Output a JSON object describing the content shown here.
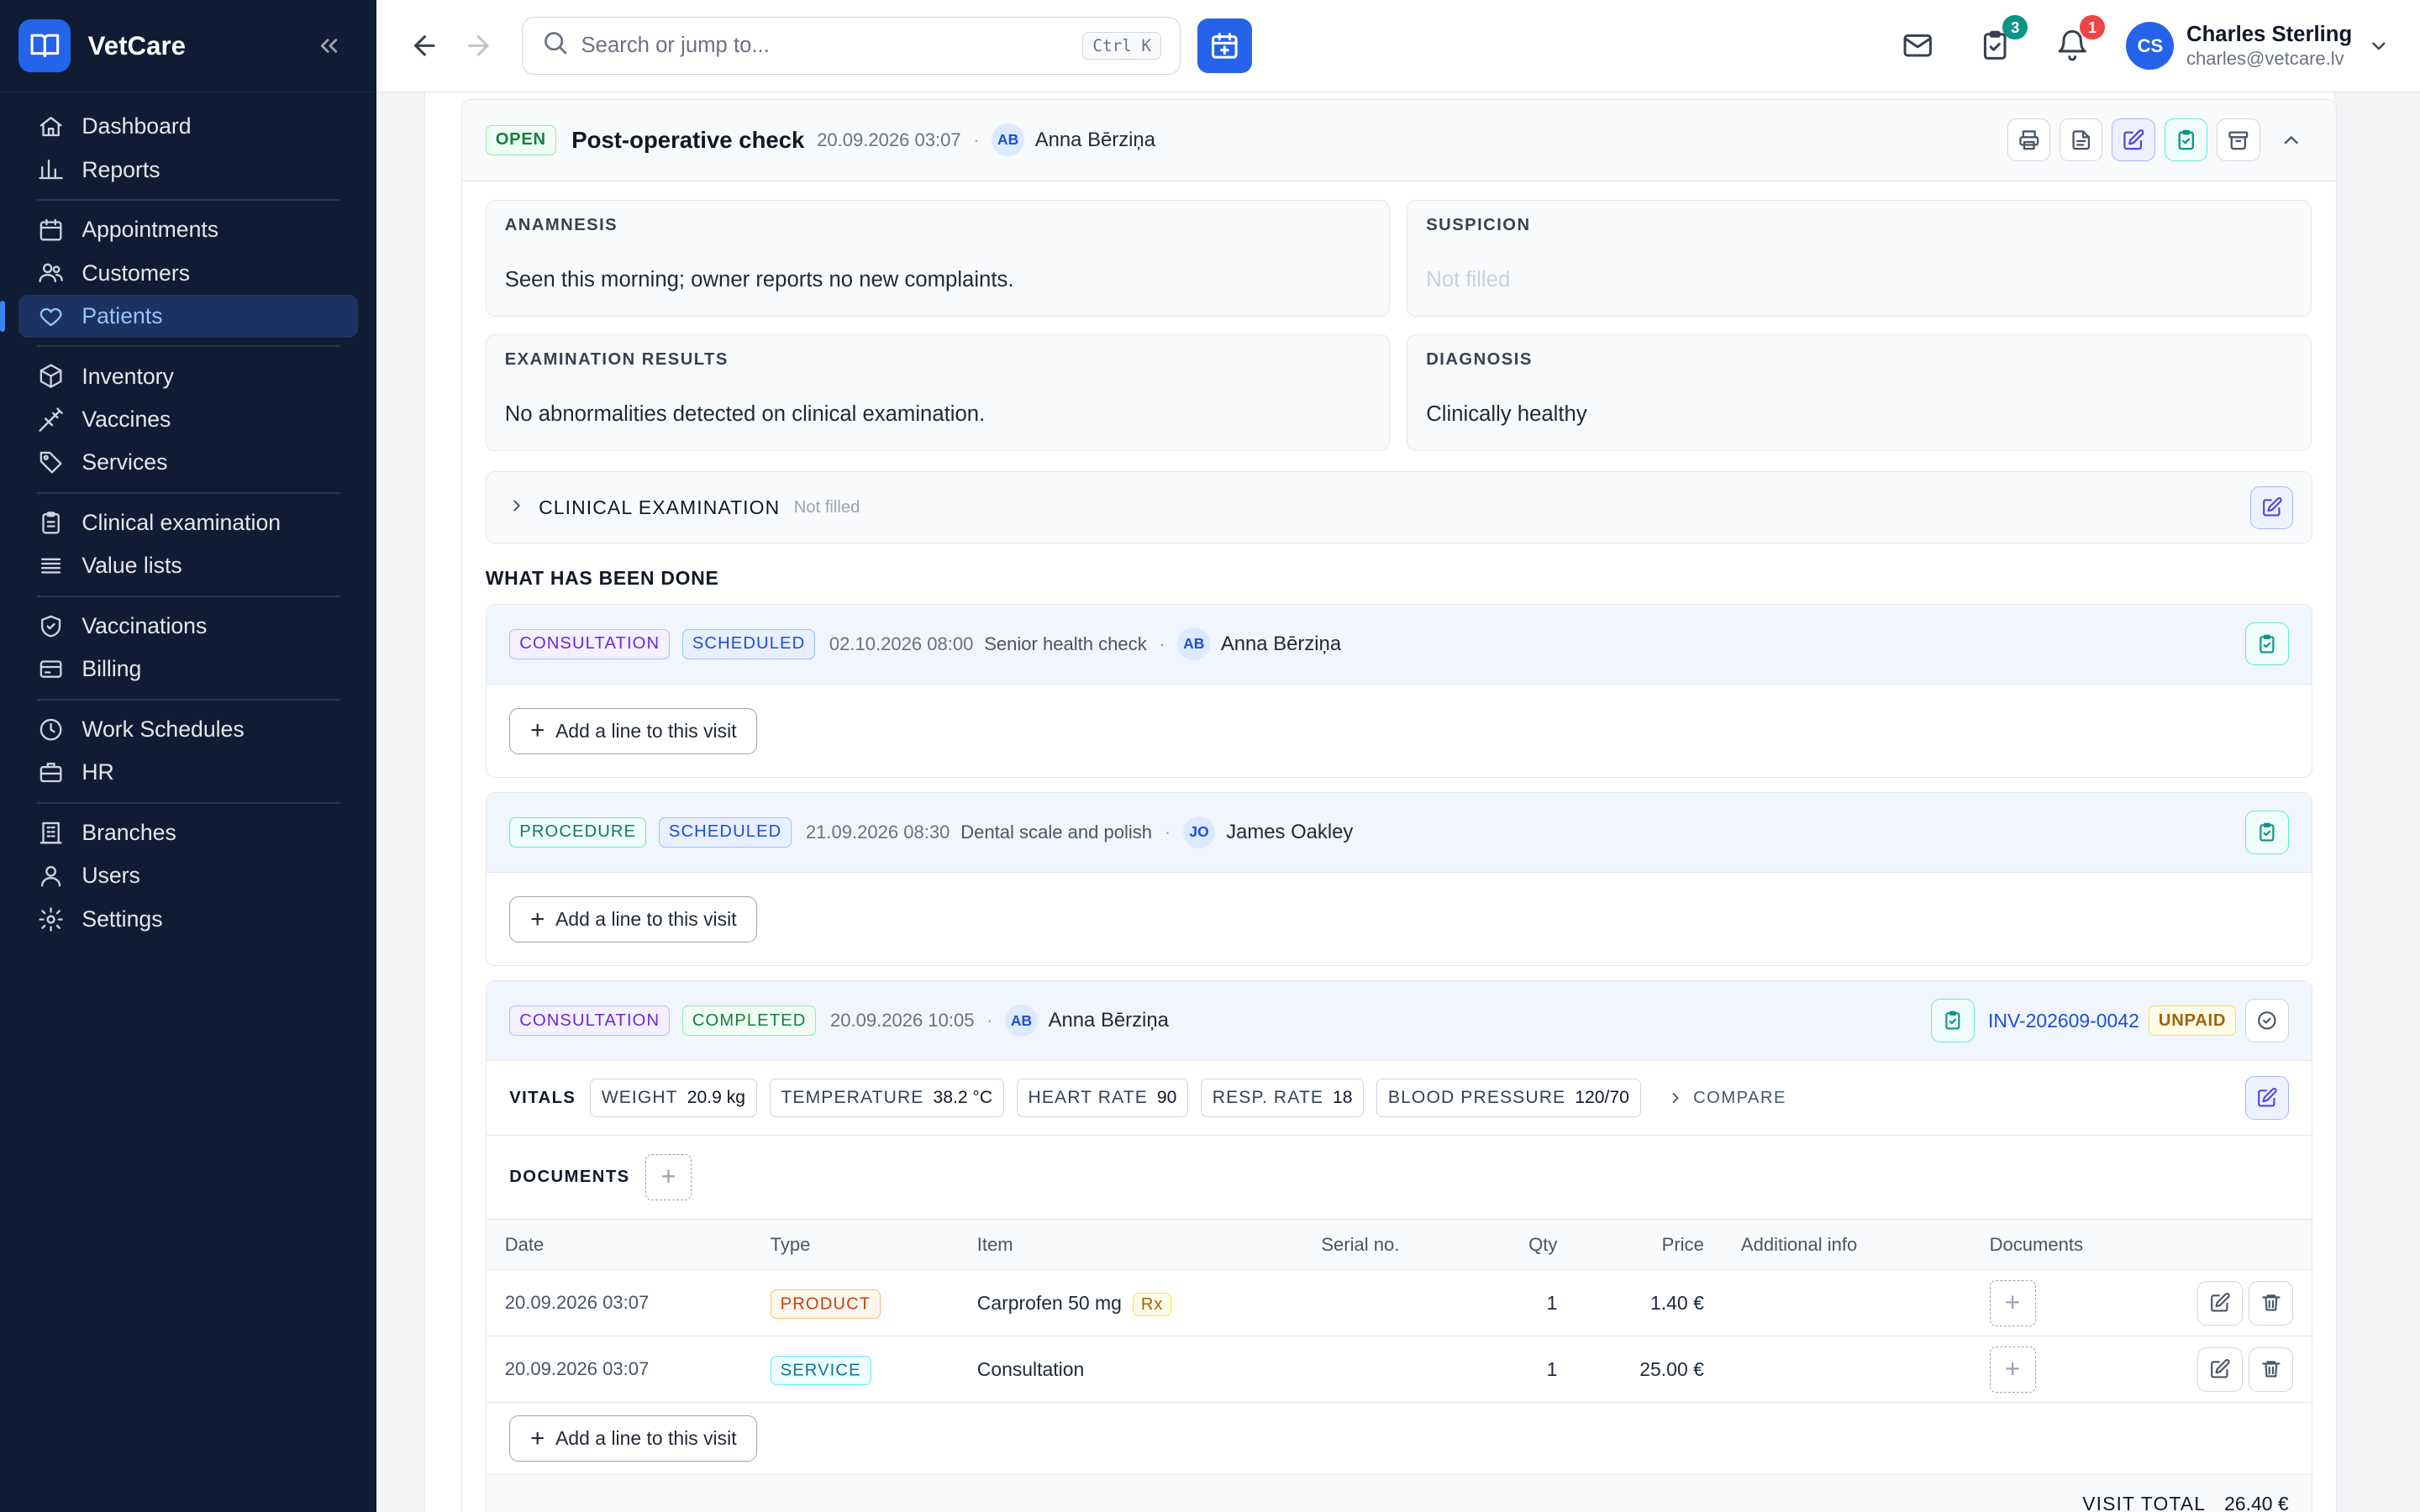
{
  "app": {
    "name": "VetCare"
  },
  "sidebar": {
    "groups": [
      [
        {
          "label": "Dashboard",
          "icon": "home-icon"
        },
        {
          "label": "Reports",
          "icon": "bar-chart-icon"
        }
      ],
      [
        {
          "label": "Appointments",
          "icon": "calendar-icon"
        },
        {
          "label": "Customers",
          "icon": "users-icon"
        },
        {
          "label": "Patients",
          "icon": "heart-icon",
          "active": true
        }
      ],
      [
        {
          "label": "Inventory",
          "icon": "box-icon"
        },
        {
          "label": "Vaccines",
          "icon": "syringe-icon"
        },
        {
          "label": "Services",
          "icon": "tag-icon"
        }
      ],
      [
        {
          "label": "Clinical examination",
          "icon": "clipboard-icon"
        },
        {
          "label": "Value lists",
          "icon": "list-icon"
        }
      ],
      [
        {
          "label": "Vaccinations",
          "icon": "shield-icon"
        },
        {
          "label": "Billing",
          "icon": "credit-card-icon"
        }
      ],
      [
        {
          "label": "Work Schedules",
          "icon": "clock-icon"
        },
        {
          "label": "HR",
          "icon": "briefcase-icon"
        }
      ],
      [
        {
          "label": "Branches",
          "icon": "building-icon"
        },
        {
          "label": "Users",
          "icon": "user-icon"
        },
        {
          "label": "Settings",
          "icon": "gear-icon"
        }
      ]
    ]
  },
  "topbar": {
    "search_placeholder": "Search or jump to...",
    "shortcut": "Ctrl K",
    "tasks_count": "3",
    "notifications_count": "1",
    "user": {
      "initials": "CS",
      "name": "Charles Sterling",
      "email": "charles@vetcare.lv"
    }
  },
  "visit": {
    "status": "OPEN",
    "title": "Post-operative check",
    "datetime": "20.09.2026 03:07",
    "vet_initials": "AB",
    "vet_name": "Anna Bērziņa",
    "anamnesis": {
      "label": "ANAMNESIS",
      "value": "Seen this morning; owner reports no new complaints."
    },
    "suspicion": {
      "label": "SUSPICION",
      "value": "Not filled"
    },
    "exam_results": {
      "label": "EXAMINATION RESULTS",
      "value": "No abnormalities detected on clinical examination."
    },
    "diagnosis": {
      "label": "DIAGNOSIS",
      "value": "Clinically healthy"
    },
    "clinical_exam": {
      "label": "CLINICAL EXAMINATION",
      "status": "Not filled"
    },
    "done_title": "WHAT HAS BEEN DONE",
    "add_line_label": "Add a line to this visit"
  },
  "lines": [
    {
      "type": "CONSULTATION",
      "status": "SCHEDULED",
      "datetime": "02.10.2026 08:00",
      "desc": "Senior health check",
      "initials": "AB",
      "person": "Anna Bērziņa"
    },
    {
      "type": "PROCEDURE",
      "status": "SCHEDULED",
      "datetime": "21.09.2026 08:30",
      "desc": "Dental scale and polish",
      "initials": "JO",
      "person": "James Oakley"
    }
  ],
  "completed": {
    "type": "CONSULTATION",
    "status": "COMPLETED",
    "datetime": "20.09.2026 10:05",
    "initials": "AB",
    "person": "Anna Bērziņa",
    "invoice": "INV-202609-0042",
    "invoice_status": "UNPAID",
    "vitals_label": "VITALS",
    "vitals": [
      {
        "k": "WEIGHT",
        "v": "20.9 kg"
      },
      {
        "k": "TEMPERATURE",
        "v": "38.2 °C"
      },
      {
        "k": "HEART RATE",
        "v": "90"
      },
      {
        "k": "RESP. RATE",
        "v": "18"
      },
      {
        "k": "BLOOD PRESSURE",
        "v": "120/70"
      }
    ],
    "compare_label": "COMPARE",
    "documents_label": "DOCUMENTS",
    "table": {
      "headers": [
        "Date",
        "Type",
        "Item",
        "Serial no.",
        "Qty",
        "Price",
        "Additional info",
        "Documents"
      ],
      "rows": [
        {
          "date": "20.09.2026 03:07",
          "type": "PRODUCT",
          "item": "Carprofen 50 mg",
          "rx": "Rx",
          "serial": "",
          "qty": "1",
          "price": "1.40 €",
          "info": ""
        },
        {
          "date": "20.09.2026 03:07",
          "type": "SERVICE",
          "item": "Consultation",
          "rx": "",
          "serial": "",
          "qty": "1",
          "price": "25.00 €",
          "info": ""
        }
      ]
    },
    "total_label": "VISIT TOTAL",
    "total_value": "26.40 €"
  }
}
